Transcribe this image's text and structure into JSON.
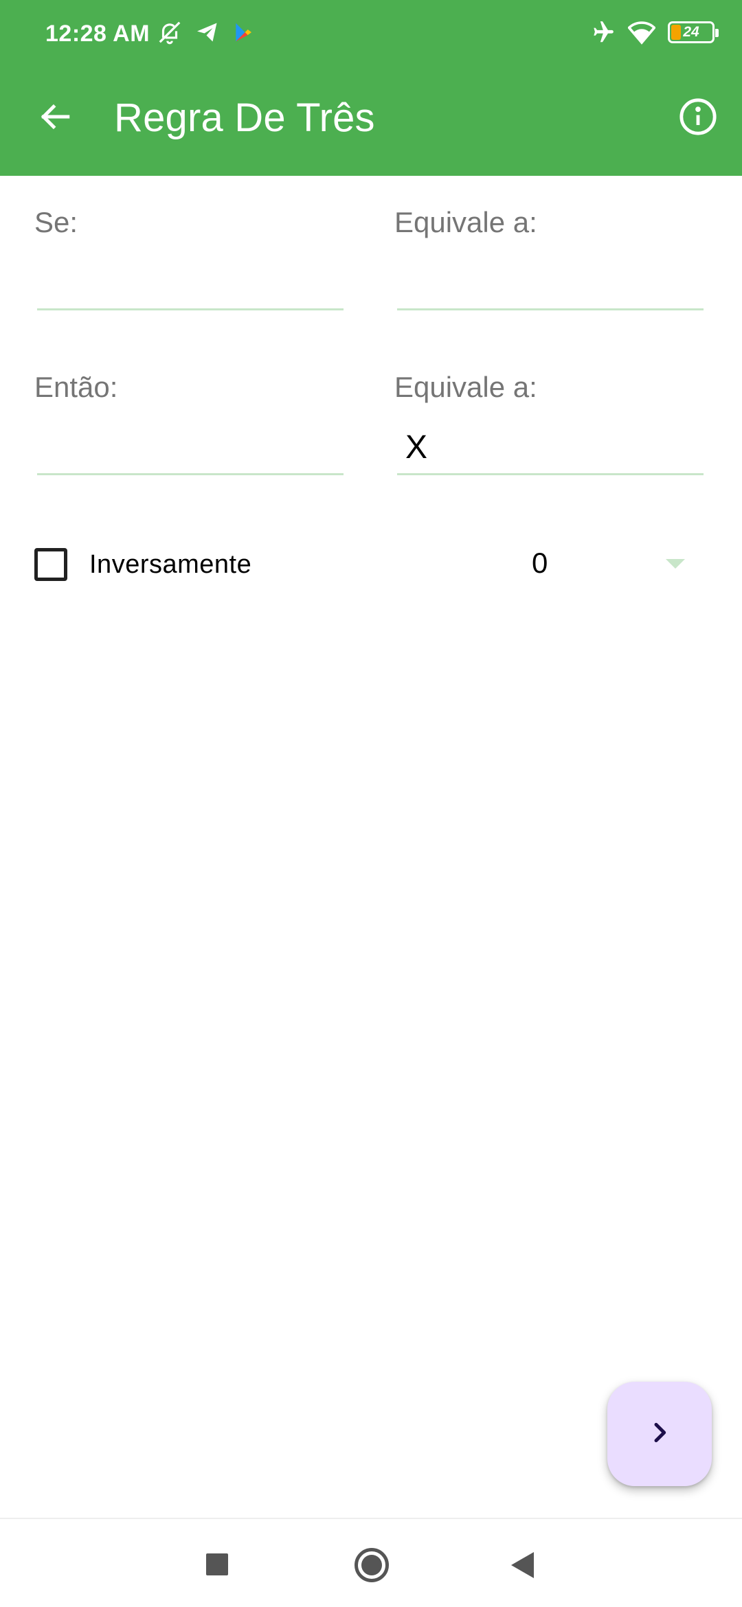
{
  "status_bar": {
    "time": "12:28 AM",
    "battery_level": "24",
    "icons_left": [
      "muted-bell-icon",
      "telegram-icon",
      "play-store-icon"
    ],
    "icons_right": [
      "airplane-icon",
      "wifi-icon",
      "battery-icon"
    ]
  },
  "app_bar": {
    "title": "Regra De Três",
    "back_icon": "arrow-left-icon",
    "info_icon": "info-icon",
    "color": "#4caf50"
  },
  "form": {
    "row1": {
      "left": {
        "label": "Se:",
        "value": ""
      },
      "right": {
        "label": "Equivale a:",
        "value": ""
      }
    },
    "row2": {
      "left": {
        "label": "Então:",
        "value": ""
      },
      "right": {
        "label": "Equivale a:",
        "value": "X"
      }
    },
    "underline_color": "#c8e6c9"
  },
  "options": {
    "checkbox_label": "Inversamente",
    "checkbox_checked": false,
    "spinner_value": "0"
  },
  "fab": {
    "icon": "chevron-right-icon",
    "color": "#eaddff"
  },
  "nav_bar": {
    "icons": [
      "recents-square-icon",
      "home-circle-icon",
      "back-triangle-icon"
    ]
  }
}
